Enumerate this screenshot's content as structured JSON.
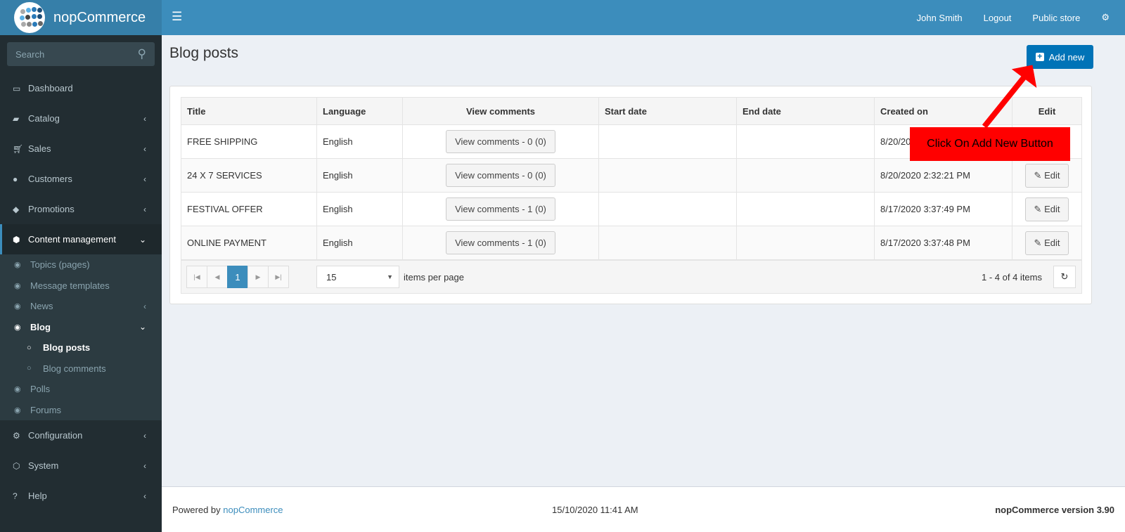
{
  "header": {
    "brand": "nopCommerce",
    "user": "John Smith",
    "logout": "Logout",
    "public_store": "Public store"
  },
  "sidebar": {
    "search_placeholder": "Search",
    "items": [
      {
        "label": "Dashboard"
      },
      {
        "label": "Catalog"
      },
      {
        "label": "Sales"
      },
      {
        "label": "Customers"
      },
      {
        "label": "Promotions"
      },
      {
        "label": "Content management"
      },
      {
        "label": "Configuration"
      },
      {
        "label": "System"
      },
      {
        "label": "Help"
      }
    ],
    "sub": [
      {
        "label": "Topics (pages)"
      },
      {
        "label": "Message templates"
      },
      {
        "label": "News"
      },
      {
        "label": "Blog"
      },
      {
        "label": "Blog posts"
      },
      {
        "label": "Blog comments"
      },
      {
        "label": "Polls"
      },
      {
        "label": "Forums"
      }
    ]
  },
  "page": {
    "title": "Blog posts",
    "add_new": "Add new"
  },
  "table": {
    "headers": [
      "Title",
      "Language",
      "View comments",
      "Start date",
      "End date",
      "Created on",
      "Edit"
    ],
    "rows": [
      {
        "title": "FREE SHIPPING",
        "language": "English",
        "comments": "View comments - 0 (0)",
        "created": "8/20/20",
        "edit": "Edit"
      },
      {
        "title": "24 X 7 SERVICES",
        "language": "English",
        "comments": "View comments - 0 (0)",
        "created": "8/20/2020 2:32:21 PM",
        "edit": "Edit"
      },
      {
        "title": "FESTIVAL OFFER",
        "language": "English",
        "comments": "View comments - 1 (0)",
        "created": "8/17/2020 3:37:49 PM",
        "edit": "Edit"
      },
      {
        "title": "ONLINE PAYMENT",
        "language": "English",
        "comments": "View comments - 1 (0)",
        "created": "8/17/2020 3:37:48 PM",
        "edit": "Edit"
      }
    ]
  },
  "pager": {
    "current": "1",
    "page_size": "15",
    "items_per_page": "items per page",
    "count": "1 - 4 of 4 items"
  },
  "annotation": {
    "text": "Click On Add New Button",
    "color": "#ff0000"
  },
  "footer": {
    "powered": "Powered by ",
    "link": "nopCommerce",
    "datetime": "15/10/2020 11:41 AM",
    "version": "nopCommerce version 3.90"
  }
}
